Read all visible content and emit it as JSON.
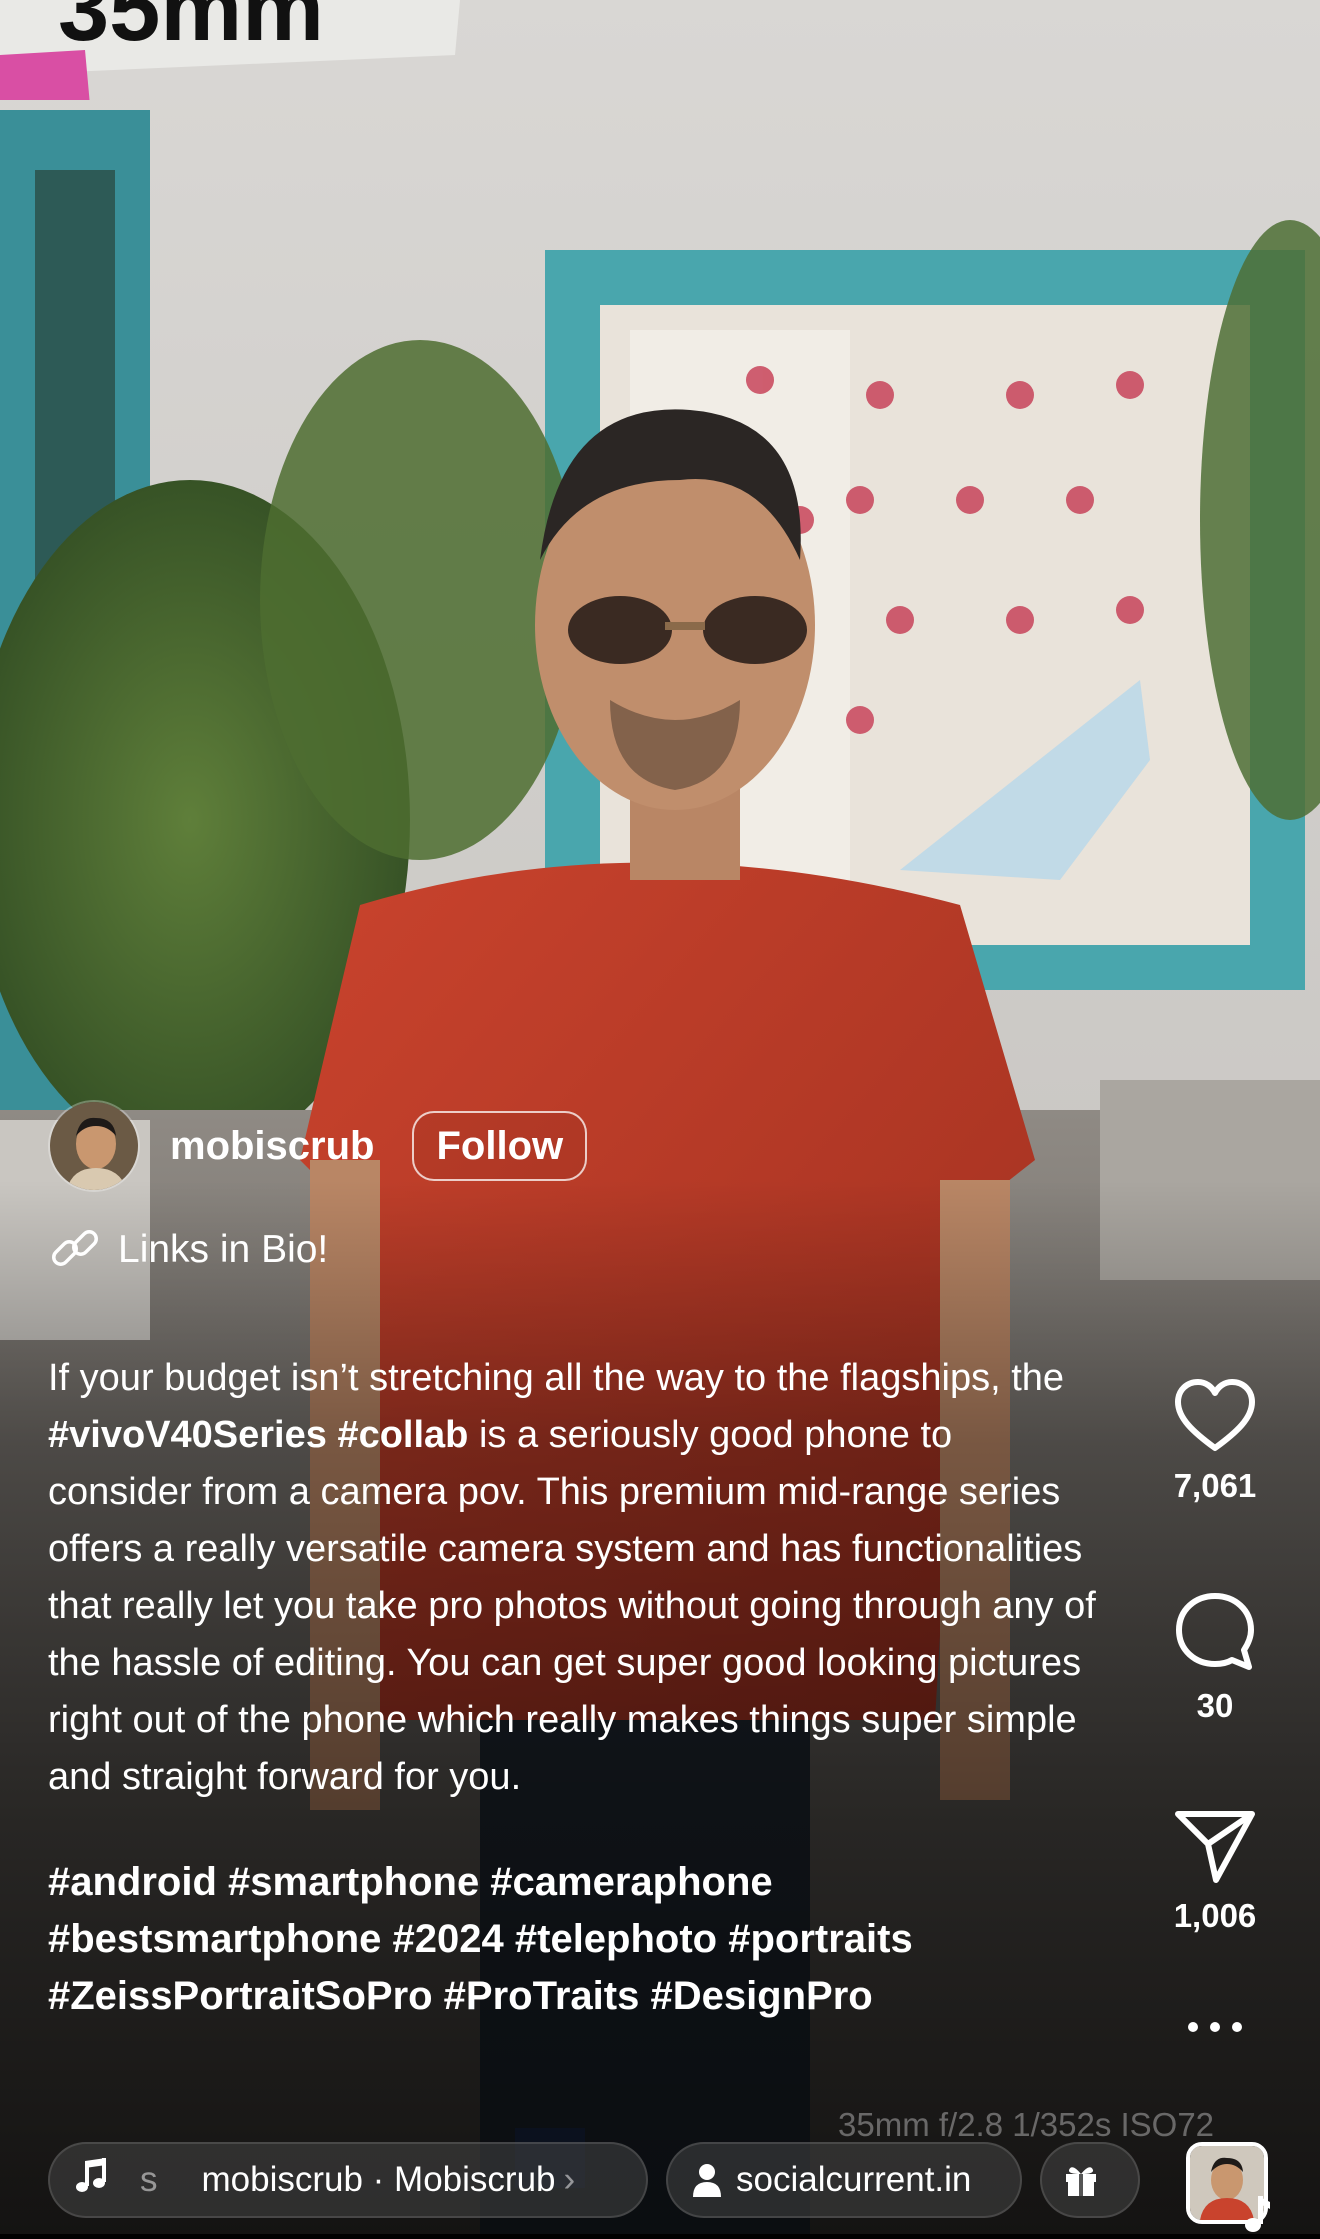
{
  "post": {
    "username": "mobiscrub",
    "follow_label": "Follow",
    "bio_link": "Links in Bio!",
    "caption": {
      "part1": "If your budget isn’t stretching all the way to the flagships, the ",
      "tag1": "#vivoV40Series",
      "space": " ",
      "tag2": "#collab",
      "part2": " is a seriously good phone to consider from a camera pov. This premium mid-range series offers a really versatile camera system and has functionalities that really let you take pro photos without going through any of the hassle of editing. You can get super good looking pictures right out of the phone which really makes things super simple and straight forward for you.",
      "hashtags": "#android #smartphone #cameraphone #bestsmartphone #2024 #telephoto #portraits #ZeissPortraitSoPro #ProTraits #DesignPro"
    },
    "photo_overlay": {
      "sticker_text": "35mm",
      "camera_watermark": "35mm  f/2.8  1/352s  ISO72"
    }
  },
  "actions": {
    "likes": "7,061",
    "comments": "30",
    "shares": "1,006",
    "more_label": "•••"
  },
  "chips": {
    "audio_s": "s",
    "audio": "mobiscrub · Mobiscrub",
    "audio_chevron": "›",
    "user_tag": "socialcurrent.in"
  },
  "icons": [
    "heart-icon",
    "comment-icon",
    "send-icon",
    "more-icon",
    "music-note-icon",
    "person-icon",
    "gift-icon",
    "link-icon"
  ]
}
